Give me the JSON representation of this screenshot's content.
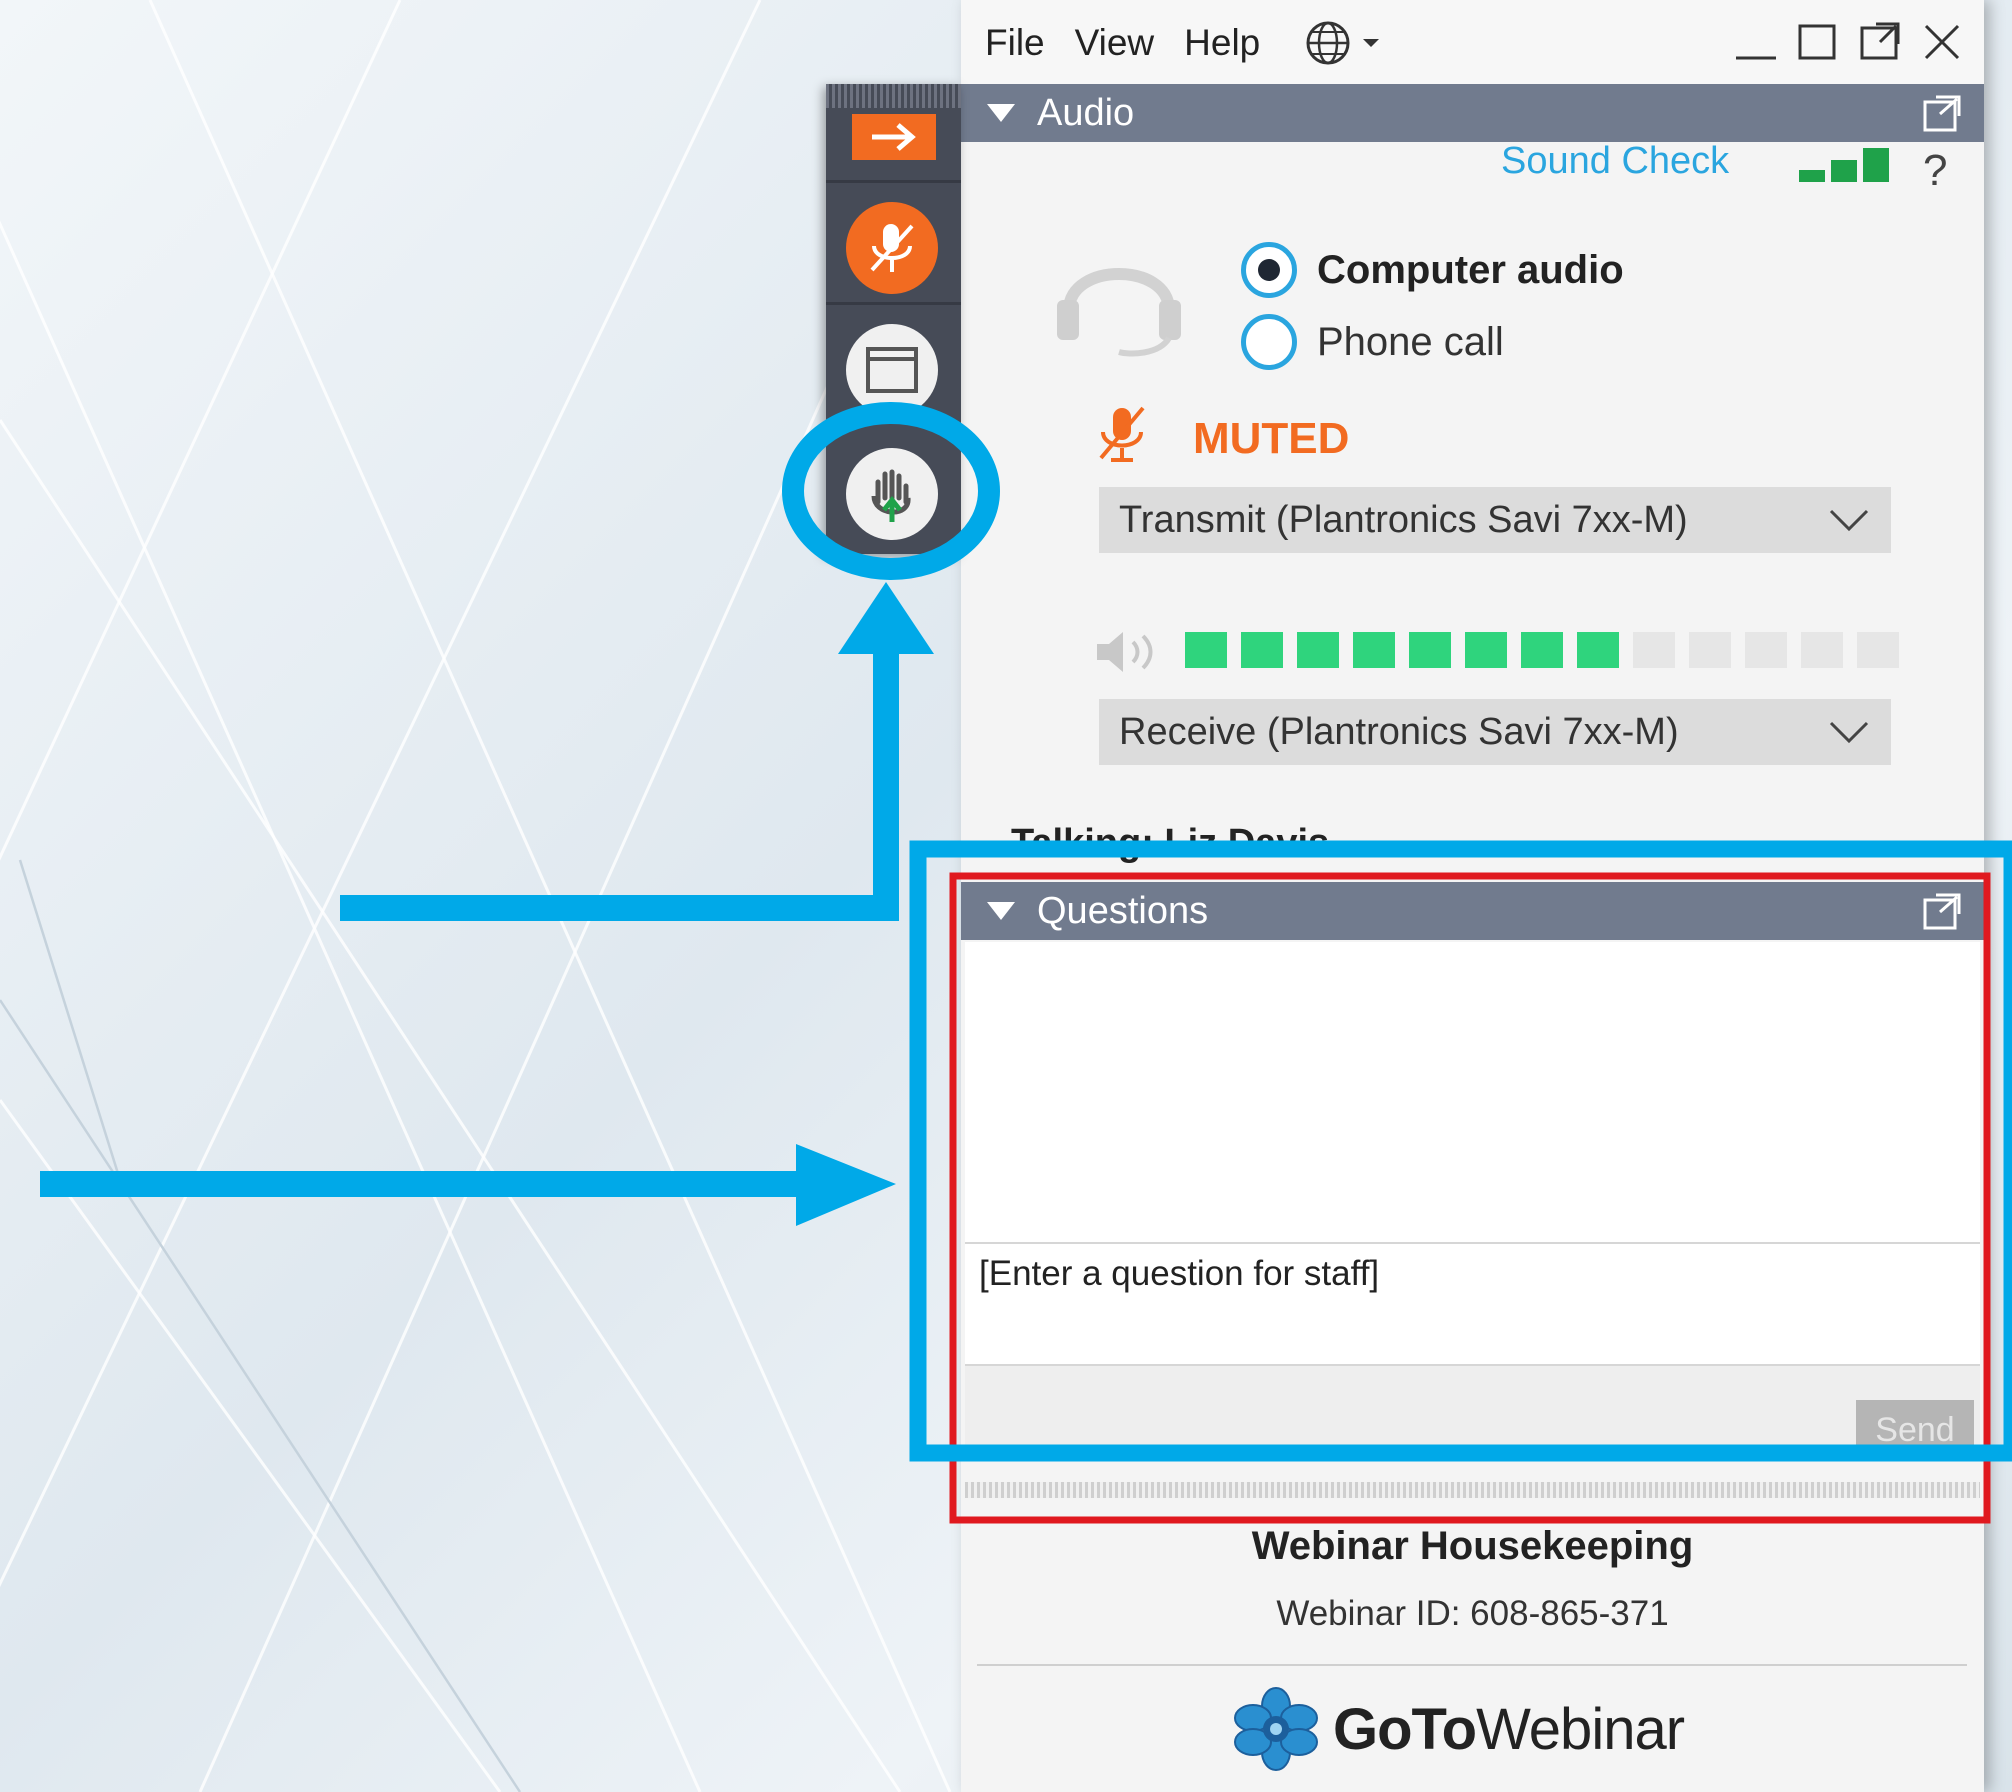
{
  "menu": {
    "file": "File",
    "view": "View",
    "help": "Help"
  },
  "audio": {
    "header": "Audio",
    "sound_check": "Sound Check",
    "help_mark": "?",
    "computer_audio": "Computer audio",
    "phone_call": "Phone call",
    "selected_mode": "Computer audio",
    "muted_label": "MUTED",
    "transmit_device": "Transmit (Plantronics Savi 7xx-M)",
    "receive_device": "Receive (Plantronics Savi 7xx-M)",
    "volume_level_filled": 8,
    "volume_level_total": 13,
    "talking_line": "Talking: Liz Davis"
  },
  "questions": {
    "header": "Questions",
    "input_placeholder": "[Enter a question for staff]",
    "send_label": "Send"
  },
  "footer": {
    "title": "Webinar Housekeeping",
    "webinar_id": "Webinar ID: 608-865-371",
    "brand_bold": "GoTo",
    "brand_regular": "Webinar"
  },
  "colors": {
    "accent_blue": "#00a9e8",
    "highlight_red": "#e0191f",
    "muted_orange": "#f26b21",
    "meter_green": "#2fd47d",
    "header_gray": "#717b8e"
  },
  "icons": {
    "grab_tab": [
      "collapse-arrow-icon",
      "mute-microphone-icon",
      "screen-view-icon",
      "raise-hand-icon"
    ],
    "headset": "headset-icon",
    "globe": "globe-icon",
    "speaker": "speaker-icon"
  }
}
